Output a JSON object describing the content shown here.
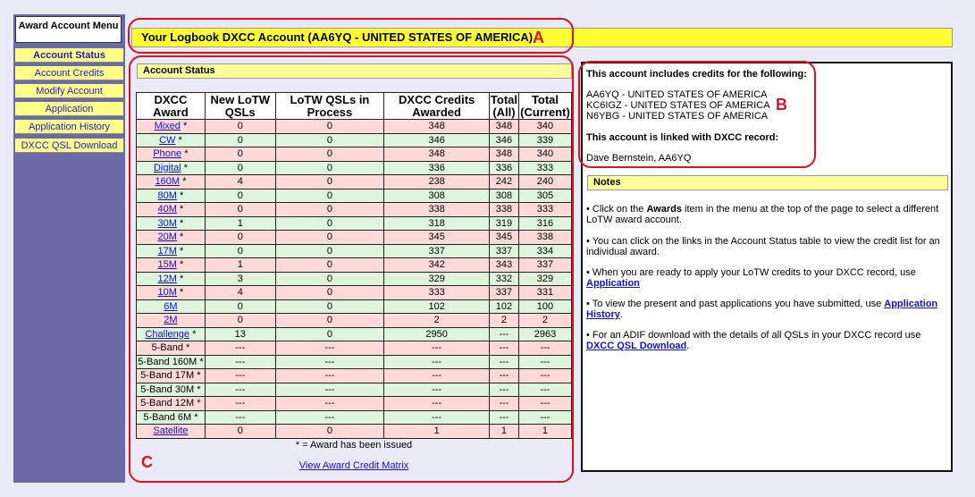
{
  "sidebar": {
    "title": "Award Account Menu",
    "items": [
      {
        "label": "Account Status"
      },
      {
        "label": "Account Credits"
      },
      {
        "label": "Modify Account"
      },
      {
        "label": "Application"
      },
      {
        "label": "Application History"
      },
      {
        "label": "DXCC QSL Download"
      }
    ]
  },
  "header": {
    "title": "Your Logbook DXCC Account (AA6YQ - UNITED STATES OF AMERICA)"
  },
  "annotations": {
    "a": "A",
    "b": "B",
    "c": "C"
  },
  "account_status": {
    "heading": "Account Status",
    "columns": [
      "DXCC Award",
      "New LoTW QSLs",
      "LoTW QSLs in Process",
      "DXCC Credits Awarded",
      "Total (All)",
      "Total (Current)"
    ],
    "rows": [
      {
        "award": "Mixed",
        "star": " *",
        "link": true,
        "new": "0",
        "process": "0",
        "credits": "348",
        "all": "348",
        "current": "340",
        "color": "pink"
      },
      {
        "award": "CW",
        "star": " *",
        "link": true,
        "new": "0",
        "process": "0",
        "credits": "346",
        "all": "346",
        "current": "339",
        "color": "green"
      },
      {
        "award": "Phone",
        "star": " *",
        "link": true,
        "new": "0",
        "process": "0",
        "credits": "348",
        "all": "348",
        "current": "340",
        "color": "pink"
      },
      {
        "award": "Digital",
        "star": " *",
        "link": true,
        "new": "0",
        "process": "0",
        "credits": "336",
        "all": "336",
        "current": "333",
        "color": "green"
      },
      {
        "award": "160M",
        "star": " *",
        "link": true,
        "new": "4",
        "process": "0",
        "credits": "238",
        "all": "242",
        "current": "240",
        "color": "pink"
      },
      {
        "award": "80M",
        "star": " *",
        "link": true,
        "new": "0",
        "process": "0",
        "credits": "308",
        "all": "308",
        "current": "305",
        "color": "green"
      },
      {
        "award": "40M",
        "star": " *",
        "link": true,
        "new": "0",
        "process": "0",
        "credits": "338",
        "all": "338",
        "current": "333",
        "color": "pink"
      },
      {
        "award": "30M",
        "star": " *",
        "link": true,
        "new": "1",
        "process": "0",
        "credits": "318",
        "all": "319",
        "current": "316",
        "color": "green"
      },
      {
        "award": "20M",
        "star": " *",
        "link": true,
        "new": "0",
        "process": "0",
        "credits": "345",
        "all": "345",
        "current": "338",
        "color": "pink"
      },
      {
        "award": "17M",
        "star": " *",
        "link": true,
        "new": "0",
        "process": "0",
        "credits": "337",
        "all": "337",
        "current": "334",
        "color": "green"
      },
      {
        "award": "15M",
        "star": " *",
        "link": true,
        "new": "1",
        "process": "0",
        "credits": "342",
        "all": "343",
        "current": "337",
        "color": "pink"
      },
      {
        "award": "12M",
        "star": " *",
        "link": true,
        "new": "3",
        "process": "0",
        "credits": "329",
        "all": "332",
        "current": "329",
        "color": "green"
      },
      {
        "award": "10M",
        "star": " *",
        "link": true,
        "new": "4",
        "process": "0",
        "credits": "333",
        "all": "337",
        "current": "331",
        "color": "pink"
      },
      {
        "award": "6M",
        "star": "",
        "link": true,
        "new": "0",
        "process": "0",
        "credits": "102",
        "all": "102",
        "current": "100",
        "color": "green"
      },
      {
        "award": "2M",
        "star": "",
        "link": true,
        "new": "0",
        "process": "0",
        "credits": "2",
        "all": "2",
        "current": "2",
        "color": "pink"
      },
      {
        "award": "Challenge",
        "star": " *",
        "link": true,
        "new": "13",
        "process": "0",
        "credits": "2950",
        "all": "---",
        "current": "2963",
        "color": "green"
      },
      {
        "award": "5-Band",
        "star": " *",
        "link": false,
        "new": "---",
        "process": "---",
        "credits": "---",
        "all": "---",
        "current": "---",
        "color": "pink"
      },
      {
        "award": "5-Band 160M",
        "star": " *",
        "link": false,
        "new": "---",
        "process": "---",
        "credits": "---",
        "all": "---",
        "current": "---",
        "color": "green"
      },
      {
        "award": "5-Band 17M",
        "star": " *",
        "link": false,
        "new": "---",
        "process": "---",
        "credits": "---",
        "all": "---",
        "current": "---",
        "color": "pink"
      },
      {
        "award": "5-Band 30M",
        "star": " *",
        "link": false,
        "new": "---",
        "process": "---",
        "credits": "---",
        "all": "---",
        "current": "---",
        "color": "green"
      },
      {
        "award": "5-Band 12M",
        "star": " *",
        "link": false,
        "new": "---",
        "process": "---",
        "credits": "---",
        "all": "---",
        "current": "---",
        "color": "pink"
      },
      {
        "award": "5-Band 6M",
        "star": " *",
        "link": false,
        "new": "---",
        "process": "---",
        "credits": "---",
        "all": "---",
        "current": "---",
        "color": "green"
      },
      {
        "award": "Satellite",
        "star": "",
        "link": true,
        "new": "0",
        "process": "0",
        "credits": "1",
        "all": "1",
        "current": "1",
        "color": "pink"
      }
    ],
    "footnote": "* = Award has been issued",
    "matrix_link": "View Award Credit Matrix"
  },
  "credits_panel": {
    "heading": "This account includes credits for the following:",
    "calls": [
      "AA6YQ - UNITED STATES OF AMERICA",
      "KC6IGZ - UNITED STATES OF AMERICA",
      "N6YBG - UNITED STATES OF AMERICA"
    ],
    "linked_heading": "This account is linked with DXCC record:",
    "linked_record": "Dave Bernstein, AA6YQ"
  },
  "notes": {
    "heading": "Notes",
    "n1_pre": "•   Click on the ",
    "n1_bold": "Awards",
    "n1_post": " item in the menu at the top of the page to select a different LoTW award account.",
    "n2": "•   You can click on the links in the Account Status table to view the credit list for an individual award.",
    "n3_pre": "•   When you are ready to apply your LoTW credits to your DXCC record, use ",
    "n3_link": "Application",
    "n4_pre": "•   To view the present and past applications you have submitted, use ",
    "n4_link": "Application History",
    "n4_post": ".",
    "n5_pre": "•   For an ADIF download with the details of all QSLs in your DXCC record use ",
    "n5_link": "DXCC QSL Download",
    "n5_post": "."
  },
  "colors": {
    "highlight_red": "#e01020",
    "title_yellow": "#ffff33",
    "sidebar_blue": "#6b6ba8"
  }
}
